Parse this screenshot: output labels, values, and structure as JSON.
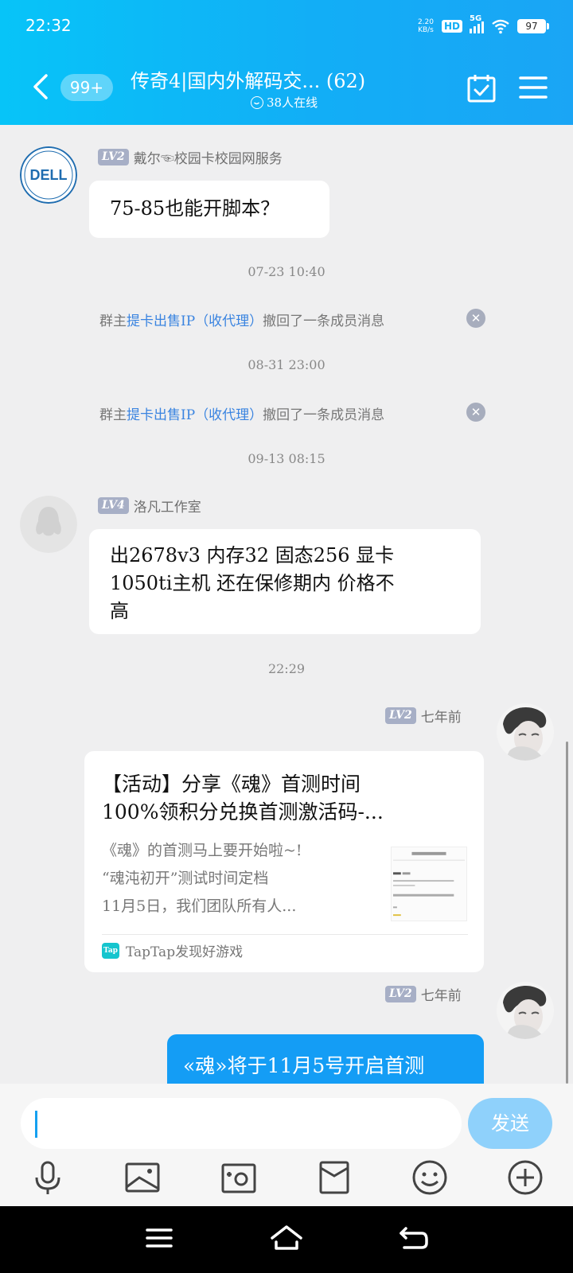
{
  "status_bar": {
    "time": "22:32",
    "net_speed_value": "2.20",
    "net_speed_unit": "KB/s",
    "hd": "HD",
    "network": "5G",
    "battery": "97"
  },
  "header": {
    "unread_badge": "99+",
    "title": "传奇4|国内外解码交...  (62)",
    "online": "38人在线"
  },
  "messages": {
    "m1": {
      "level": "LV2",
      "sender": "戴尔☜校园卡校园网服务",
      "text": "75-85也能开脚本？"
    },
    "ts1": "07-23 10:40",
    "sys1": {
      "prefix": "群主",
      "link": "提卡出售IP（收代理）",
      "suffix": "撤回了一条成员消息"
    },
    "ts2": "08-31 23:00",
    "sys2": {
      "prefix": "群主",
      "link": "提卡出售IP（收代理）",
      "suffix": "撤回了一条成员消息"
    },
    "ts3": "09-13 08:15",
    "m2": {
      "level": "LV4",
      "sender": "洛凡工作室",
      "text_lines": [
        "出2678v3 内存32 固态256 显卡",
        "1050ti主机 还在保修期内 价格不",
        "高"
      ]
    },
    "ts4": "22:29",
    "m3": {
      "level": "LV2",
      "sender": "七年前",
      "card_title": "【活动】分享《魂》首测时间\n100%领积分兑换首测激活码-...",
      "card_desc": "《魂》的首测马上要开始啦~!\n“魂沌初开”测试时间定档\n11月5日，我们团队所有人...",
      "source_logo": "Tap",
      "source": "TapTap发现好游戏"
    },
    "m4": {
      "level": "LV2",
      "sender": "七年前",
      "text": "«魂»将于11月5号开启首测"
    }
  },
  "input": {
    "placeholder": "",
    "send_label": "发送"
  },
  "toolbar_icons": [
    "microphone-icon",
    "image-icon",
    "camera-icon",
    "red-packet-icon",
    "emoji-icon",
    "plus-icon"
  ],
  "colors": {
    "header_start": "#07c4f8",
    "header_end": "#1aa5f5",
    "link": "#3a84e0",
    "my_bubble": "#149df5",
    "send_button": "#8fd1fb"
  }
}
